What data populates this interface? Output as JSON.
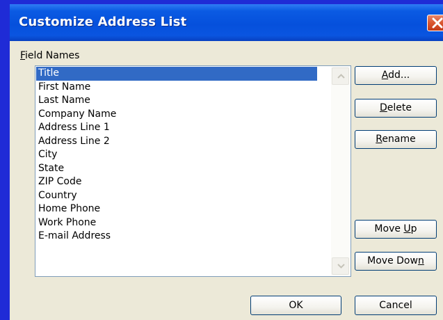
{
  "dialog": {
    "title": "Customize Address List"
  },
  "field_names": {
    "label_mnemonic": "F",
    "label_rest": "ield Names",
    "selected_index": 0,
    "items": [
      "Title",
      "First Name",
      "Last Name",
      "Company Name",
      "Address Line 1",
      "Address Line 2",
      "City",
      "State",
      "ZIP Code",
      "Country",
      "Home Phone",
      "Work Phone",
      "E-mail Address"
    ]
  },
  "buttons": {
    "add": {
      "mnemonic": "A",
      "rest": "dd..."
    },
    "delete": {
      "mnemonic": "D",
      "rest": "elete"
    },
    "rename": {
      "mnemonic": "R",
      "rest": "ename"
    },
    "move_up": {
      "before": "Move ",
      "mnemonic": "U",
      "after": "p"
    },
    "move_down": {
      "before": "Move Dow",
      "mnemonic": "n",
      "after": ""
    },
    "ok": "OK",
    "cancel": "Cancel"
  },
  "icons": {
    "close": "close-icon",
    "scroll_up": "chevron-up-icon",
    "scroll_down": "chevron-down-icon"
  },
  "colors": {
    "desktop_background": "#1f2bd6",
    "title_bar": "#0550dc",
    "close_button": "#d9562f",
    "selection": "#316ac5",
    "dialog_face": "#ece9d8"
  }
}
